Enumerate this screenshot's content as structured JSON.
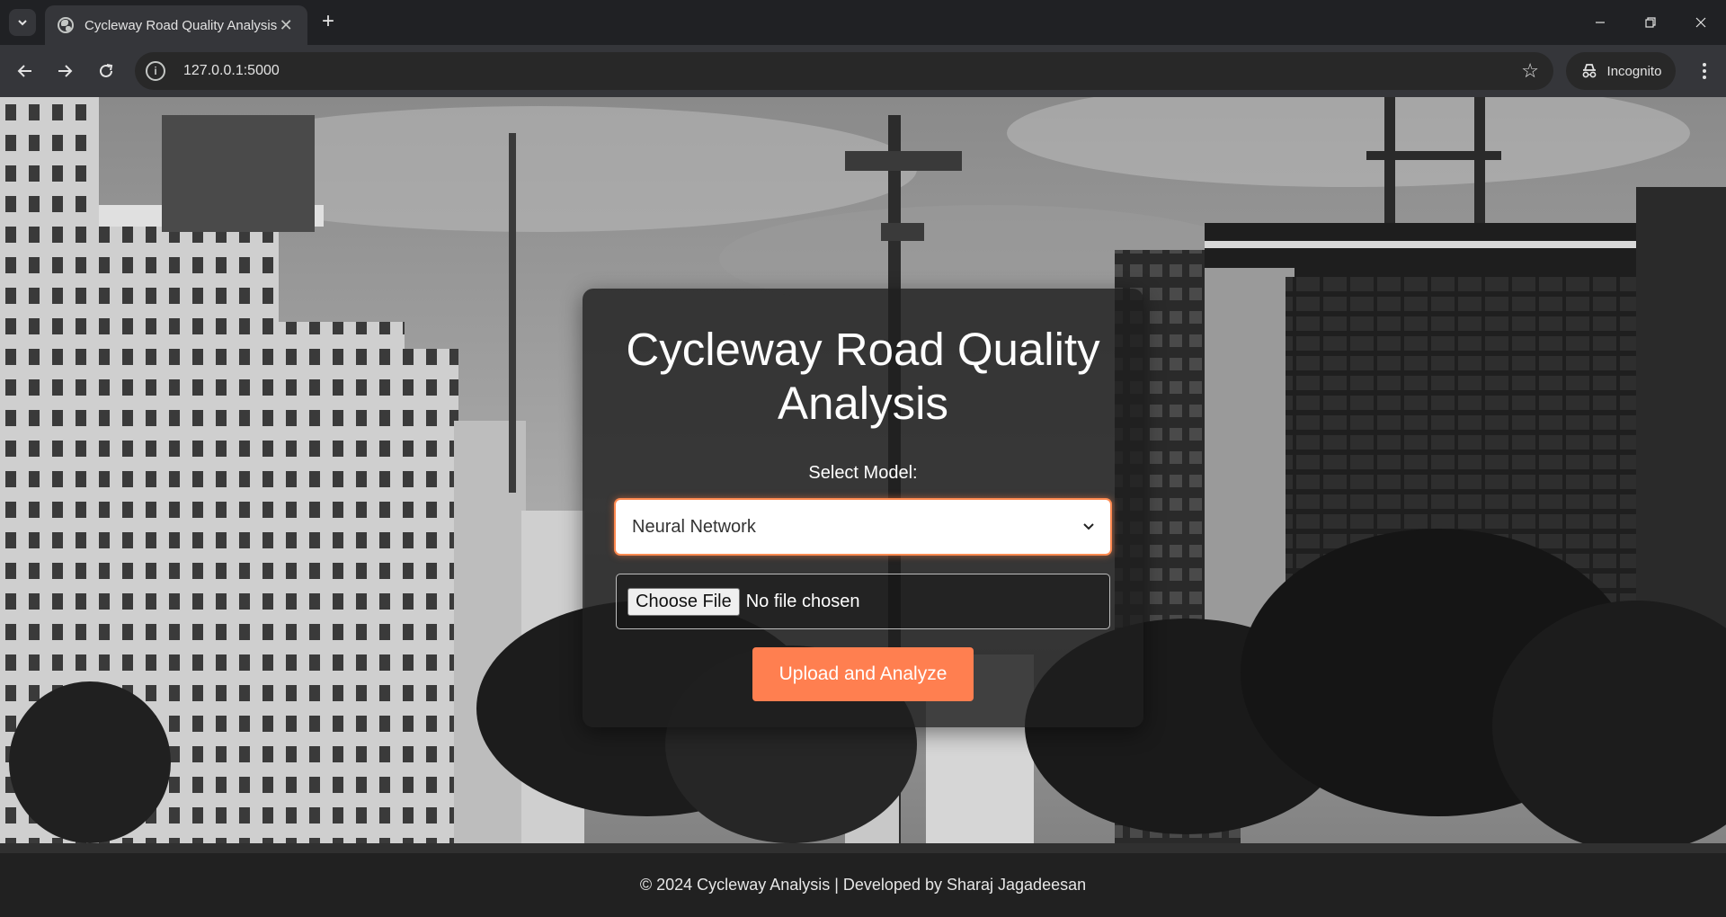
{
  "browser": {
    "tab_title": "Cycleway Road Quality Analysis",
    "url": "127.0.0.1:5000",
    "incognito_label": "Incognito"
  },
  "page": {
    "title": "Cycleway Road Quality Analysis",
    "model_label": "Select Model:",
    "model_select": {
      "selected": "Neural Network"
    },
    "file_input": {
      "button_label": "Choose File",
      "status": "No file chosen"
    },
    "submit_label": "Upload and Analyze",
    "footer": "© 2024 Cycleway Analysis | Developed by Sharaj Jagadeesan"
  },
  "colors": {
    "accent": "#ff7f50",
    "card_bg": "#1e1e1e",
    "chrome_bg": "#202124"
  },
  "icons": [
    "tab-search-icon",
    "globe-favicon-icon",
    "close-icon",
    "plus-icon",
    "minimize-icon",
    "restore-icon",
    "back-arrow-icon",
    "forward-arrow-icon",
    "reload-icon",
    "site-info-icon",
    "bookmark-star-icon",
    "incognito-icon",
    "kebab-menu-icon",
    "chevron-down-icon"
  ]
}
